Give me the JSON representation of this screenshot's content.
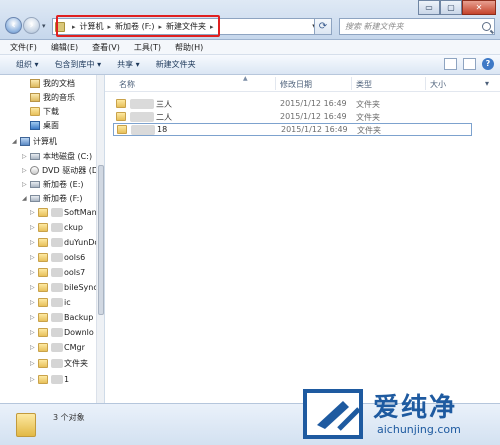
{
  "window": {
    "minimize": "▭",
    "maximize": "▢",
    "close": "✕"
  },
  "address": {
    "crumbs": [
      "计算机",
      "新加卷 (F:)",
      "新建文件夹"
    ],
    "search_placeholder": "搜索 新建文件夹"
  },
  "menubar": [
    "文件(F)",
    "编辑(E)",
    "查看(V)",
    "工具(T)",
    "帮助(H)"
  ],
  "toolbar": [
    "组织 ▾",
    "包含到库中 ▾",
    "共享 ▾",
    "新建文件夹"
  ],
  "nav": {
    "library_items": [
      "我的文档",
      "我的音乐",
      "下载",
      "桌面"
    ],
    "computer": "计算机",
    "drives": [
      "本地磁盘 (C:)",
      "DVD 驱动器 (D:",
      "新加卷 (E:)",
      "新加卷 (F:)"
    ],
    "folders": [
      "SoftMan",
      "ckup",
      "duYunDo",
      "ools6",
      "ools7",
      "bileSync",
      "ic",
      "Backup",
      "Downlo",
      "CMgr",
      "文件夹",
      "1"
    ]
  },
  "columns": {
    "name": "名称",
    "date": "修改日期",
    "type": "类型",
    "size": "大小"
  },
  "files": [
    {
      "name": "三人",
      "date": "2015/1/12 16:49",
      "type": "文件夹"
    },
    {
      "name": "二人",
      "date": "2015/1/12 16:49",
      "type": "文件夹"
    },
    {
      "name": "18",
      "date": "2015/1/12 16:49",
      "type": "文件夹"
    }
  ],
  "status": {
    "count": "3 个对象"
  },
  "watermark": {
    "title": "爱纯净",
    "url": "aichunjing.com"
  }
}
